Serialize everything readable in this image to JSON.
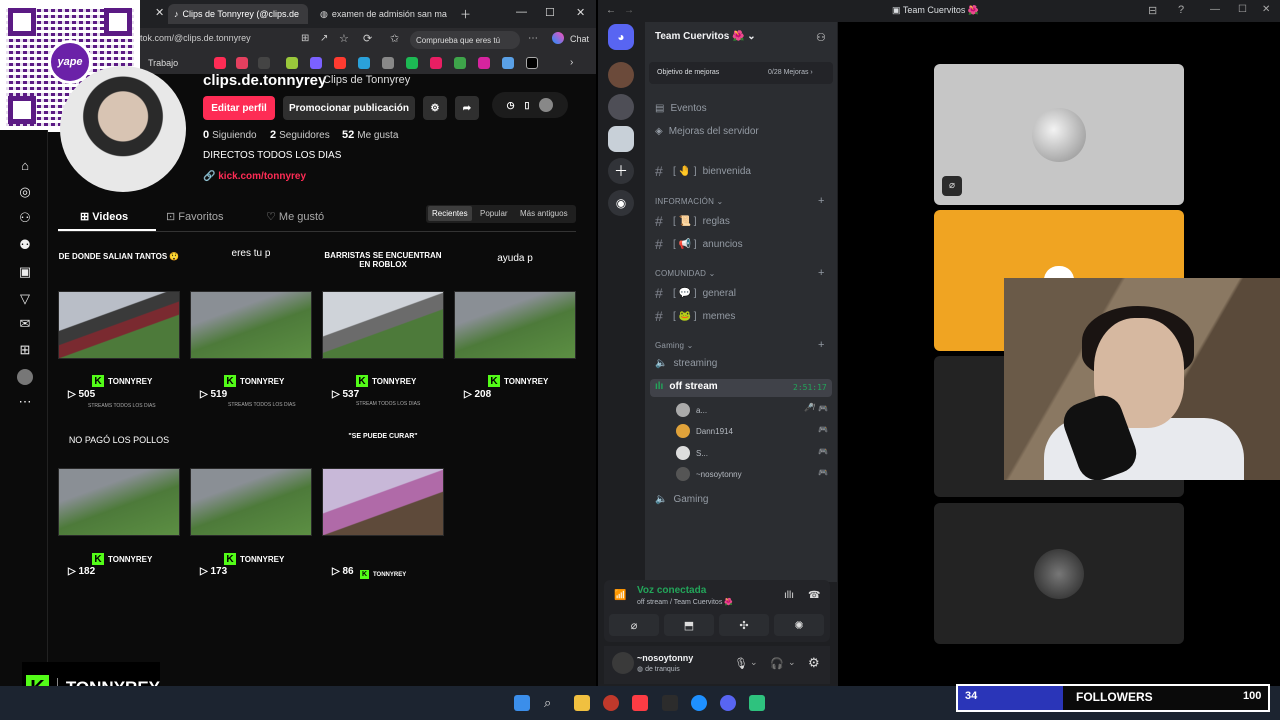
{
  "browser": {
    "tabs": [
      {
        "label": "Clips de Tonnyrey (@clips.de"
      },
      {
        "label": "examen de admisión san ma"
      }
    ],
    "url": "tok.com/@clips.de.tonnyrey",
    "copilot_label": "Comprueba que eres tú",
    "chat_label": "Chat",
    "bookmark_label": "Trabajo"
  },
  "qr": {
    "logo_text": "yape"
  },
  "profile": {
    "handle": "clips.de.tonnyrey",
    "display_name": "Clips de Tonnyrey",
    "edit_button": "Editar perfil",
    "promote_button": "Promocionar publicación",
    "stats": [
      {
        "value": "0",
        "label": "Siguiendo"
      },
      {
        "value": "2",
        "label": "Seguidores"
      },
      {
        "value": "52",
        "label": "Me gusta"
      }
    ],
    "bio": "DIRECTOS TODOS LOS DIAS",
    "link": "kick.com/tonnyrey",
    "tabs": [
      "Videos",
      "Favoritos",
      "Me gustó"
    ],
    "sort": [
      "Recientes",
      "Popular",
      "Más antiguos"
    ]
  },
  "videos": [
    {
      "caption": "DE DONDE SALIAN TANTOS 😲",
      "views": "505",
      "brand": "TONNYREY",
      "sub": "STREAMS TODOS LOS DIAS"
    },
    {
      "caption": "eres tu p",
      "views": "519",
      "brand": "TONNYREY",
      "sub": "STREAMS TODOS LOS DIAS"
    },
    {
      "caption": "BARRISTAS SE ENCUENTRAN EN ROBLOX",
      "views": "537",
      "brand": "TONNYREY",
      "sub": "STREAM TODOS LOS DIAS"
    },
    {
      "caption": "ayuda p",
      "views": "208",
      "brand": "TONNYREY",
      "sub": ""
    },
    {
      "caption": "NO PAGÓ LOS POLLOS",
      "views": "182",
      "brand": "TONNYREY",
      "sub": ""
    },
    {
      "caption": "",
      "views": "173",
      "brand": "TONNYREY",
      "sub": ""
    },
    {
      "caption": "\"SE PUEDE CURAR\"",
      "views": "86",
      "brand": "TONNYREY",
      "sub": ""
    }
  ],
  "overlay_brand": "TONNYREY",
  "discord": {
    "window_title": "Team Cuervitos 🌺",
    "server_name": "Team Cuervitos 🌺",
    "boost_label": "Objetivo de mejoras",
    "boost_count": "0/28 Mejoras",
    "events": "Eventos",
    "server_boosts": "Mejoras del servidor",
    "channels": {
      "welcome": "bienvenida",
      "info_category": "INFORMACIÓN",
      "rules": "reglas",
      "announcements": "anuncios",
      "community_category": "COMUNIDAD",
      "general": "general",
      "memes": "memes",
      "gaming_category": "Gaming",
      "streaming": "streaming",
      "off_stream": "off stream",
      "off_stream_time": "2:51:17",
      "gaming_voice": "Gaming"
    },
    "voice_users": [
      "a...",
      "Dann1914",
      "S...",
      "~nosoytonny"
    ],
    "voice_connected": "Voz conectada",
    "voice_location": "off stream / Team Cuervitos 🌺",
    "user_name": "~nosoytonny",
    "user_status": "de tranquis"
  },
  "followers": {
    "count": "34",
    "label": "FOLLOWERS",
    "goal": "100",
    "progress": 0.34
  }
}
